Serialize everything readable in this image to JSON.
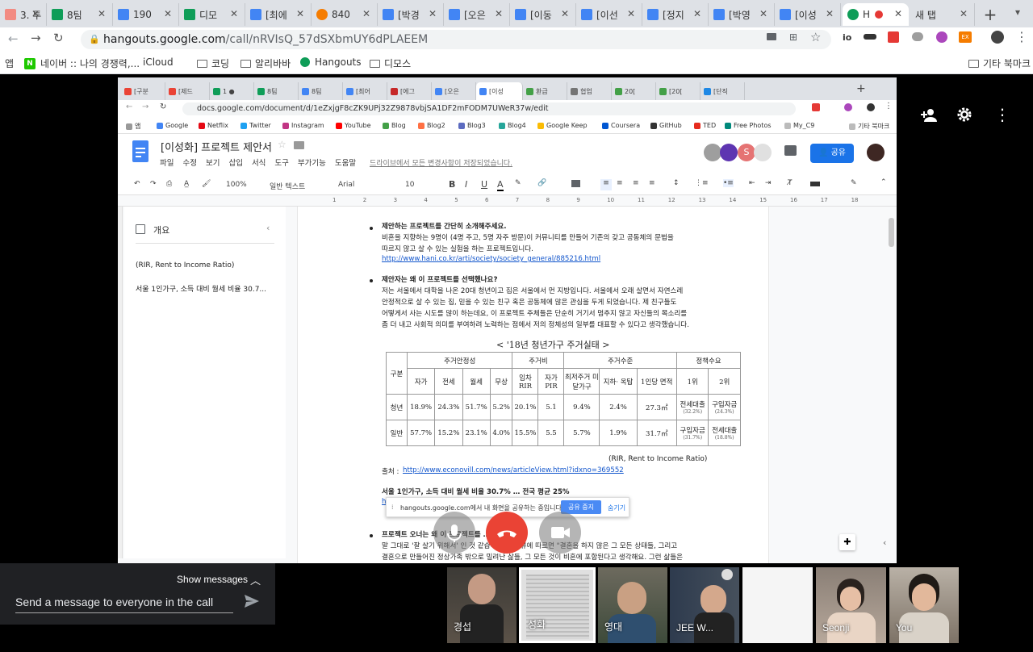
{
  "browser": {
    "tabs": [
      {
        "label": "3. 투",
        "color": "#f28b82"
      },
      {
        "label": "8팀",
        "color": "#0f9d58"
      },
      {
        "label": "190",
        "color": "#4285f4"
      },
      {
        "label": "디모",
        "color": "#0f9d58"
      },
      {
        "label": "[최에",
        "color": "#4285f4"
      },
      {
        "label": "840",
        "color": "#f57c00"
      },
      {
        "label": "[박경",
        "color": "#4285f4"
      },
      {
        "label": "[오은",
        "color": "#4285f4"
      },
      {
        "label": "[이동",
        "color": "#4285f4"
      },
      {
        "label": "[이선",
        "color": "#4285f4"
      },
      {
        "label": "[정지",
        "color": "#4285f4"
      },
      {
        "label": "[박영",
        "color": "#4285f4"
      },
      {
        "label": "[이성",
        "color": "#4285f4"
      },
      {
        "label": "H",
        "color": "#0f9d58"
      },
      {
        "label": "새 탭",
        "color": "#dee1e6"
      }
    ],
    "url_host": "hangouts.google.com",
    "url_path": "/call/nRVIsQ_57dSXbmUY6dPLAEEM",
    "bookmarks": [
      "앱",
      "네이버 :: 나의 경쟁력,...",
      "iCloud",
      "코딩",
      "알리바바",
      "Hangouts",
      "디모스",
      "기타 북마크"
    ]
  },
  "shared": {
    "inner_tabs": [
      "[구분",
      "[제드",
      "1 ●",
      "8팀",
      "8팀",
      "[최어",
      "[에그",
      "[오은",
      "[이성",
      "환급",
      "협업",
      "20[",
      "[20[",
      "[단직"
    ],
    "inner_url": "docs.google.com/document/d/1eZxjgF8cZK9UPj32Z9878vbjSA1DF2mFODM7UWeR37w/edit",
    "inner_bookmarks": [
      "앱",
      "Google",
      "Netflix",
      "Twitter",
      "Instagram",
      "YouTube",
      "Blog",
      "Blog2",
      "Blog3",
      "Blog4",
      "Google Keep",
      "Coursera",
      "GitHub",
      "TED",
      "Free Photos",
      "My_C9",
      "기타 북마크"
    ],
    "doc_title": "[이성화] 프로젝트 제안서",
    "menu": [
      "파일",
      "수정",
      "보기",
      "삽입",
      "서식",
      "도구",
      "부가기능",
      "도움말"
    ],
    "save_status": "드라이브에서 모든 변경사항이 저장되었습니다.",
    "share_label": "공유",
    "toolbar": {
      "zoom": "100%",
      "style": "일반 텍스트",
      "font": "Arial",
      "size": "10"
    },
    "outline": {
      "title": "개요",
      "items": [
        "(RIR, Rent to Income Ratio)",
        "서울 1인가구, 소득 대비 월세 비율 30.7..."
      ]
    },
    "ruler_numbers": [
      "1",
      "2",
      "3",
      "4",
      "5",
      "6",
      "7",
      "8",
      "9",
      "10",
      "11",
      "12",
      "13",
      "14",
      "15",
      "16",
      "17",
      "18"
    ],
    "page": {
      "q1": "제안하는 프로젝트를 간단히 소개해주세요.",
      "q1_lines": [
        "비혼을 지향하는 9명이 (4명 주고, 5명 자주 방문)이 커뮤니티를 만들어 기존의 갖고 공동체의 문법을",
        "따르지 않고 살 수 있는 실험을 하는 프로젝트입니다."
      ],
      "q1_link": "http://www.hani.co.kr/arti/society/society_general/885216.html",
      "q2": "제안자는 왜 이 프로젝트를 선택했나요?",
      "q2_lines": [
        "저는 서울에서 대학을 나온 20대 청년이고 집은 서울에서 먼 지방입니다. 서울에서 오래 살면서 자연스레",
        "안정적으로 살 수 있는 집, 믿을 수 있는 친구 혹은 공동체에 많은 관심을 두게 되었습니다. 제 친구들도",
        "어떻게서 사는 시도를 많이 하는데요, 이 프로젝트 주체들은 단순히 거기서 멈추지 않고 자신들의 목소리를",
        "좀 더 내고 사회적 의미를 부여하려 노력하는 점에서 저의 정체성의 일부를 대표할 수 있다고 생각했습니다."
      ],
      "table_title": "< '18년 청년가구 주거실태 >",
      "table": {
        "group_label": "구분",
        "groups": [
          "주거안정성",
          "주거비",
          "주거수준",
          "정책수요"
        ],
        "columns": [
          "자가",
          "전세",
          "월세",
          "무상",
          "임차 RIR",
          "자가 PIR",
          "최저주거 미달가구",
          "지하· 옥탑",
          "1인당 면적",
          "1위",
          "2위"
        ],
        "rows": [
          {
            "label": "청년",
            "values": [
              "18.9%",
              "24.3%",
              "51.7%",
              "5.2%",
              "20.1%",
              "5.1",
              "9.4%",
              "2.4%",
              "27.3㎡"
            ],
            "rank1": "전세대출",
            "rank1_pct": "(32.2%)",
            "rank2": "구입자금",
            "rank2_pct": "(24.3%)"
          },
          {
            "label": "일반",
            "values": [
              "57.7%",
              "15.2%",
              "23.1%",
              "4.0%",
              "15.5%",
              "5.5",
              "5.7%",
              "1.9%",
              "31.7㎡"
            ],
            "rank1": "구입자금",
            "rank1_pct": "(31.7%)",
            "rank2": "전세대출",
            "rank2_pct": "(18.8%)"
          }
        ]
      },
      "rir_note": "(RIR, Rent to Income Ratio)",
      "source_label": "출처 :",
      "source_link": "http://www.econovill.com/news/articleView.html?idxno=369552",
      "heading3": "서울 1인가구, 소득 대비 월세 비율 30.7% … 전국 평균 25%",
      "link3": "h",
      "q3": "프로젝트 오너는 왜 이 프로젝트를 … 나요?",
      "q3_lines": [
        "말 그대로 '잘 살기 위해서' 인 것 같습니다. 인터뷰에 따르면 \"결혼을 하지 않은 그 모든 상태들, 그리고",
        "결혼으로 만들어진 정상가족 밖으로 밀려난 삶들, 그 모든 것이 비혼에 포함된다고 생각해요. 그런 삶들은"
      ]
    },
    "sharebar": {
      "message": "hangouts.google.com에서 내 화면을 공유하는 중입니다.",
      "stop": "공유 중지",
      "hide": "숨기기"
    }
  },
  "hangouts": {
    "show_messages": "Show messages",
    "message_placeholder": "Send a message to everyone in the call",
    "participants": [
      "경섭",
      "성화",
      "영대",
      "JEE W...",
      "",
      "Seonji",
      "You"
    ]
  }
}
